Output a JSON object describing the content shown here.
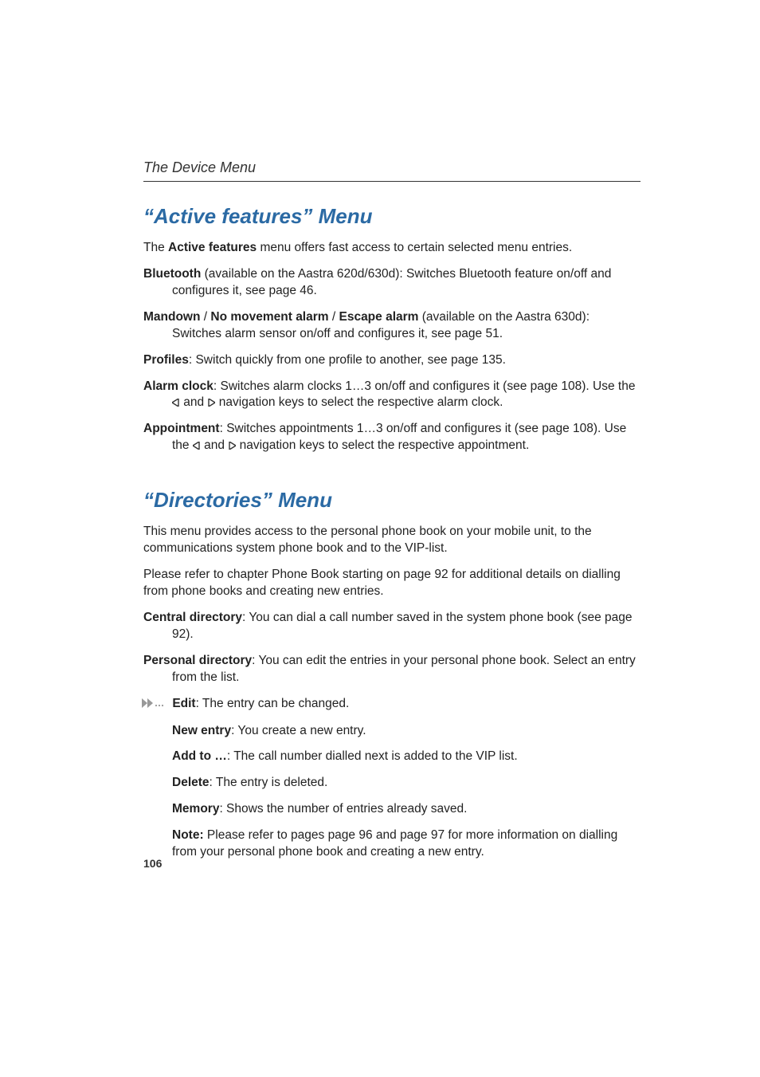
{
  "running_head": "The Device Menu",
  "page_number": "106",
  "section1": {
    "title": "“Active features” Menu",
    "intro_pre": "The ",
    "intro_bold": "Active features",
    "intro_post": " menu offers fast access to certain selected menu entries.",
    "bluetooth_bold": "Bluetooth",
    "bluetooth_rest": " (available on the Aastra 620d/630d): Switches Bluetooth feature on/off and configures it, see page 46.",
    "mandown_b1": "Mandown",
    "mandown_sep1": " / ",
    "mandown_b2": "No movement alarm",
    "mandown_sep2": " / ",
    "mandown_b3": "Escape alarm",
    "mandown_rest": " (available on the Aastra 630d): Switches alarm sensor on/off and configures it, see page 51.",
    "profiles_bold": "Profiles",
    "profiles_rest": ": Switch quickly from one profile to another, see page 135.",
    "alarm_bold": "Alarm clock",
    "alarm_rest1": ": Switches alarm clocks 1…3 on/off and configures it (see page 108). Use the ",
    "alarm_rest2": " and ",
    "alarm_rest3": " navigation keys to select the respective alarm clock.",
    "appt_bold": "Appointment",
    "appt_rest1": ": Switches appointments 1…3 on/off and configures it (see page 108). Use the ",
    "appt_rest2": " and ",
    "appt_rest3": " navigation keys to select the respective appointment."
  },
  "section2": {
    "title": "“Directories” Menu",
    "p1": "This menu provides access to the personal phone book on your mobile unit, to the communications system phone book and to the VIP-list.",
    "p2": "Please refer to chapter Phone Book starting on page 92 for additional details on dialling from phone books and creating new entries.",
    "central_bold": "Central directory",
    "central_rest": ": You can dial a call number saved in the system phone book (see page 92).",
    "personal_bold": "Personal directory",
    "personal_rest": ": You can edit the entries in your personal phone book. Select an entry from the list.",
    "edit_bold": "Edit",
    "edit_rest": ": The entry can be changed.",
    "new_bold": "New entry",
    "new_rest": ": You create a new entry.",
    "add_bold": "Add to …",
    "add_rest": ": The call number dialled next is added to the VIP list.",
    "delete_bold": "Delete",
    "delete_rest": ": The entry is deleted.",
    "memory_bold": "Memory",
    "memory_rest": ": Shows the number of entries already saved.",
    "note_bold": "Note:",
    "note_rest": " Please refer to pages page 96 and page 97 for more information on dialling from your personal phone book and creating a new entry."
  }
}
